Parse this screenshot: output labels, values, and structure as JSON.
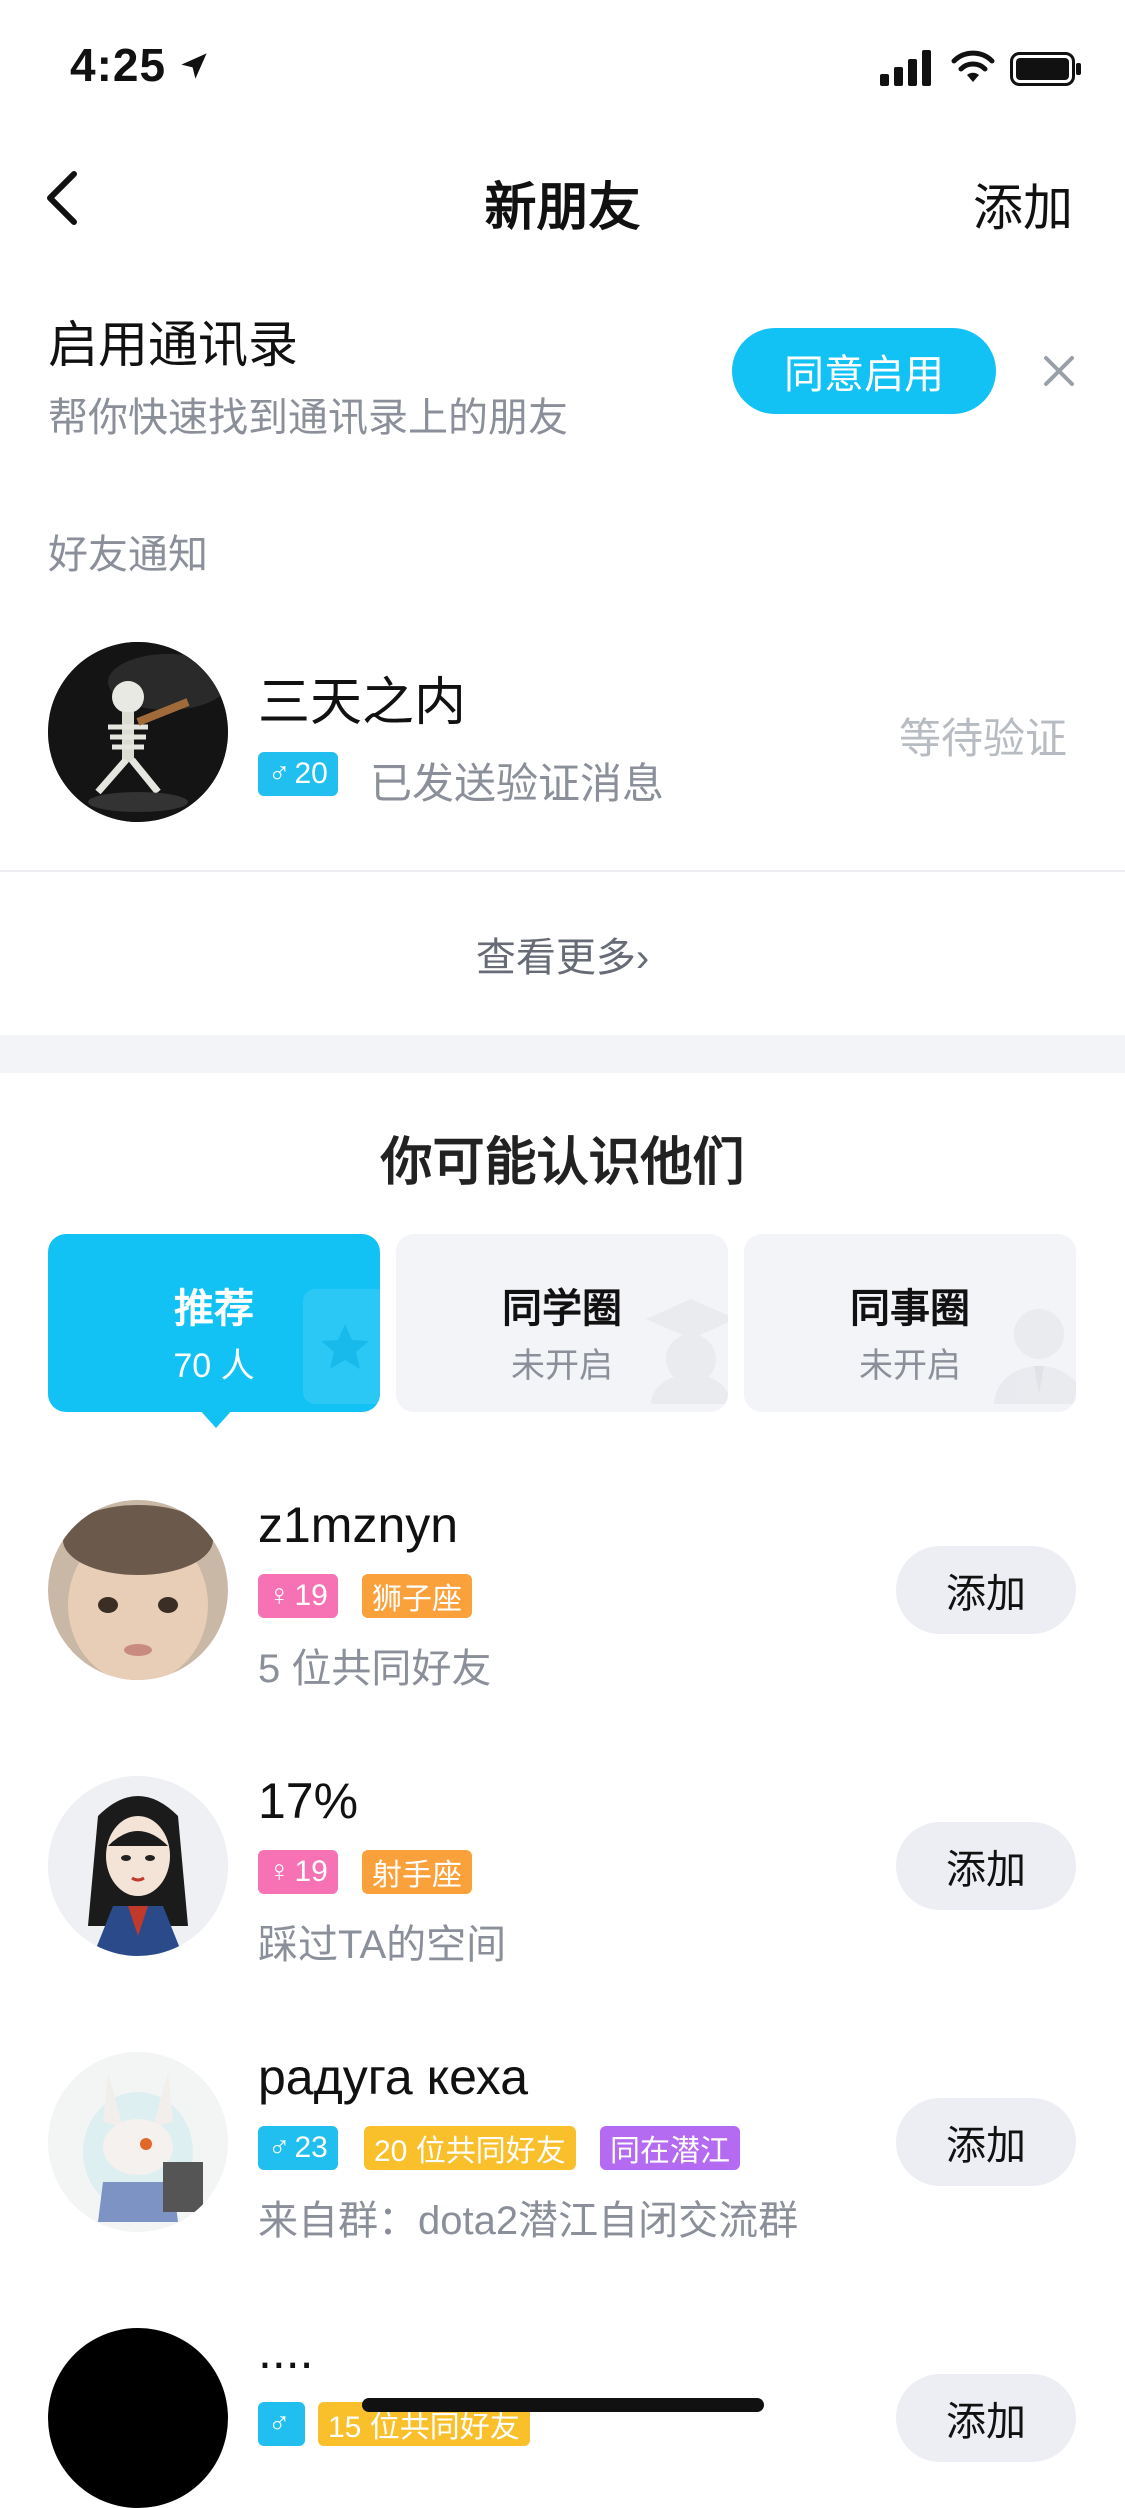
{
  "status_bar": {
    "time": "4:25"
  },
  "nav": {
    "title": "新朋友",
    "add_label": "添加"
  },
  "contacts_banner": {
    "title": "启用通讯录",
    "subtitle": "帮你快速找到通讯录上的朋友",
    "enable_label": "同意启用"
  },
  "notifications": {
    "section_label": "好友通知",
    "item": {
      "name": "三天之内",
      "gender_symbol": "♂",
      "age": "20",
      "message": "已发送验证消息",
      "status": "等待验证"
    },
    "see_more": "查看更多"
  },
  "may_know": {
    "title": "你可能认识他们",
    "tabs": [
      {
        "title": "推荐",
        "sub": "70 人"
      },
      {
        "title": "同学圈",
        "sub": "未开启"
      },
      {
        "title": "同事圈",
        "sub": "未开启"
      }
    ],
    "people": [
      {
        "name": "z1mznyn",
        "gender_symbol": "♀",
        "age": "19",
        "tags": [
          "狮子座"
        ],
        "sub": "5 位共同好友",
        "add_label": "添加"
      },
      {
        "name": "17%",
        "gender_symbol": "♀",
        "age": "19",
        "tags": [
          "射手座"
        ],
        "sub": "踩过TA的空间",
        "add_label": "添加"
      },
      {
        "name": "радуга кеха",
        "gender_symbol": "♂",
        "age": "23",
        "tags": [
          "20 位共同好友",
          "同在潜江"
        ],
        "sub": "来自群：dota2潜江自闭交流群",
        "add_label": "添加"
      },
      {
        "name": "....",
        "gender_symbol": "♂",
        "age": "",
        "tags": [
          "15 位共同好友"
        ],
        "sub": "",
        "add_label": "添加"
      }
    ]
  },
  "colors": {
    "accent": "#12c2f4",
    "male_badge": "#21bfef",
    "female_badge": "#f772b5",
    "orange_badge": "#fba13b",
    "yellow_badge": "#f9c02c",
    "purple_badge": "#b46af1"
  },
  "icons": [
    "location-arrow-icon",
    "signal-icon",
    "wifi-icon",
    "battery-icon",
    "back-chevron-icon",
    "close-icon",
    "chevron-right-icon",
    "star-bookmark-icon",
    "graduate-icon",
    "worker-icon"
  ]
}
